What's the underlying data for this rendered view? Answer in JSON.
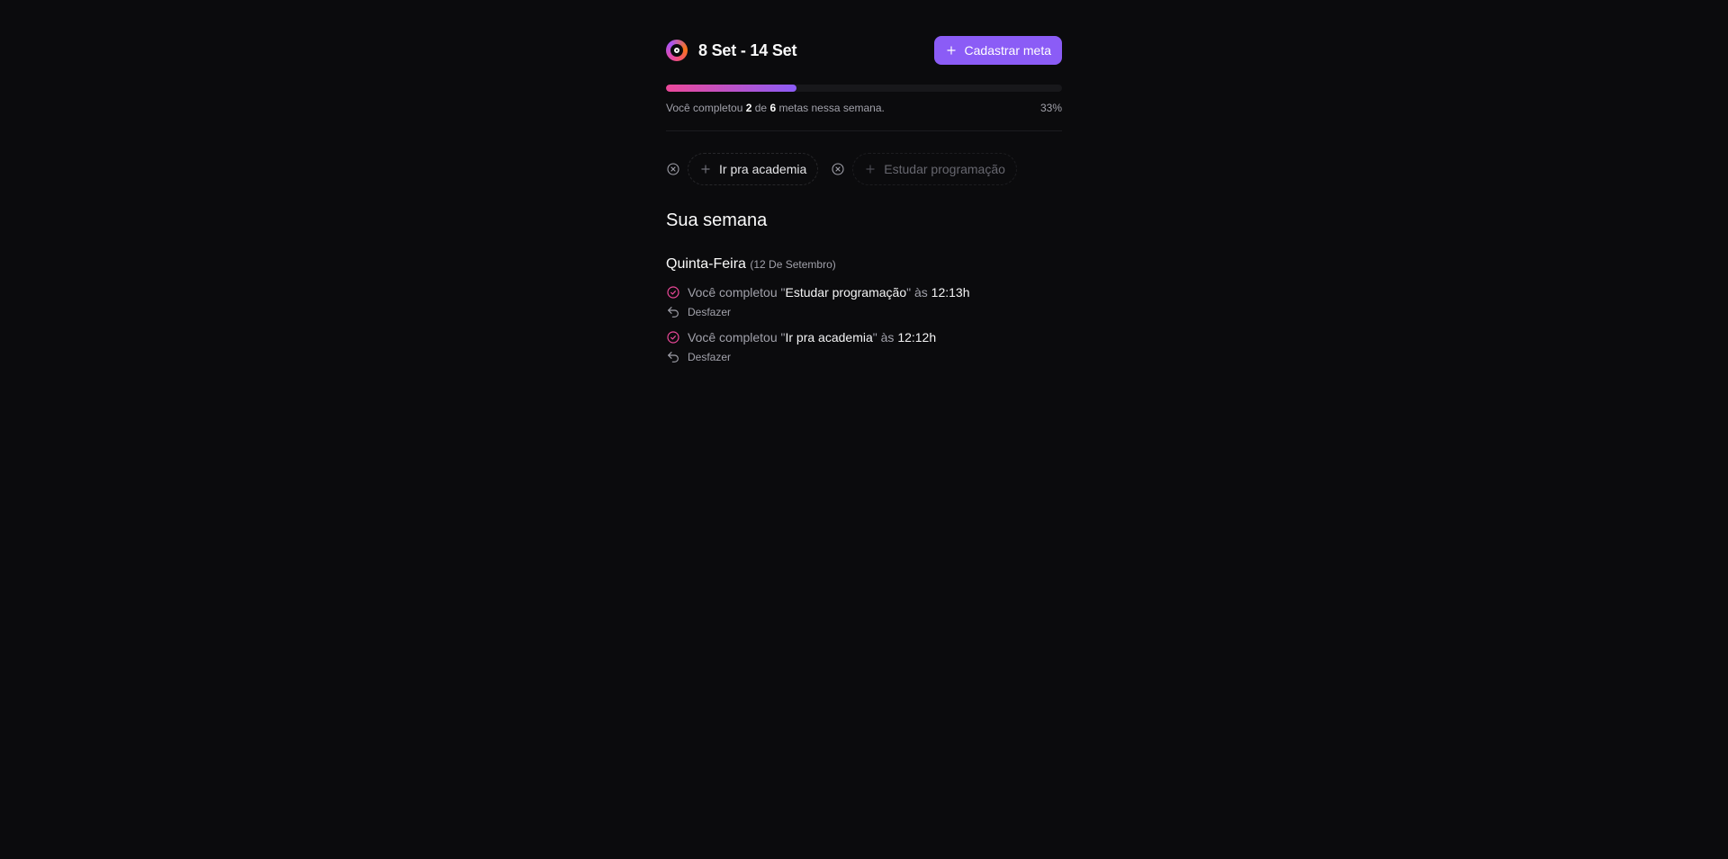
{
  "header": {
    "week_title": "8 Set - 14 Set",
    "create_button_label": "Cadastrar meta"
  },
  "progress": {
    "completed": "2",
    "total": "6",
    "text_before": "Você completou ",
    "text_middle": " de ",
    "text_after": " metas nessa semana.",
    "percent_label": "33%",
    "fraction": 0.33,
    "gradient_start": "#ec4899",
    "gradient_end": "#8b5cf6"
  },
  "pending_goals": [
    {
      "label": "Ir pra academia",
      "disabled": false
    },
    {
      "label": "Estudar programação",
      "disabled": true
    }
  ],
  "week": {
    "title": "Sua semana",
    "days": [
      {
        "weekday": "Quinta-Feira",
        "date": "(12 De Setembro)",
        "entries": [
          {
            "prefix": "Você completou \"",
            "goal": "Estudar programação",
            "middle": "\" às ",
            "time": "12:13h",
            "undo_label": "Desfazer"
          },
          {
            "prefix": "Você completou \"",
            "goal": "Ir pra academia",
            "middle": "\" às ",
            "time": "12:12h",
            "undo_label": "Desfazer"
          }
        ]
      }
    ]
  },
  "colors": {
    "background": "#0b0b0d",
    "accent": "#8b5cf6",
    "check": "#ec4899"
  }
}
